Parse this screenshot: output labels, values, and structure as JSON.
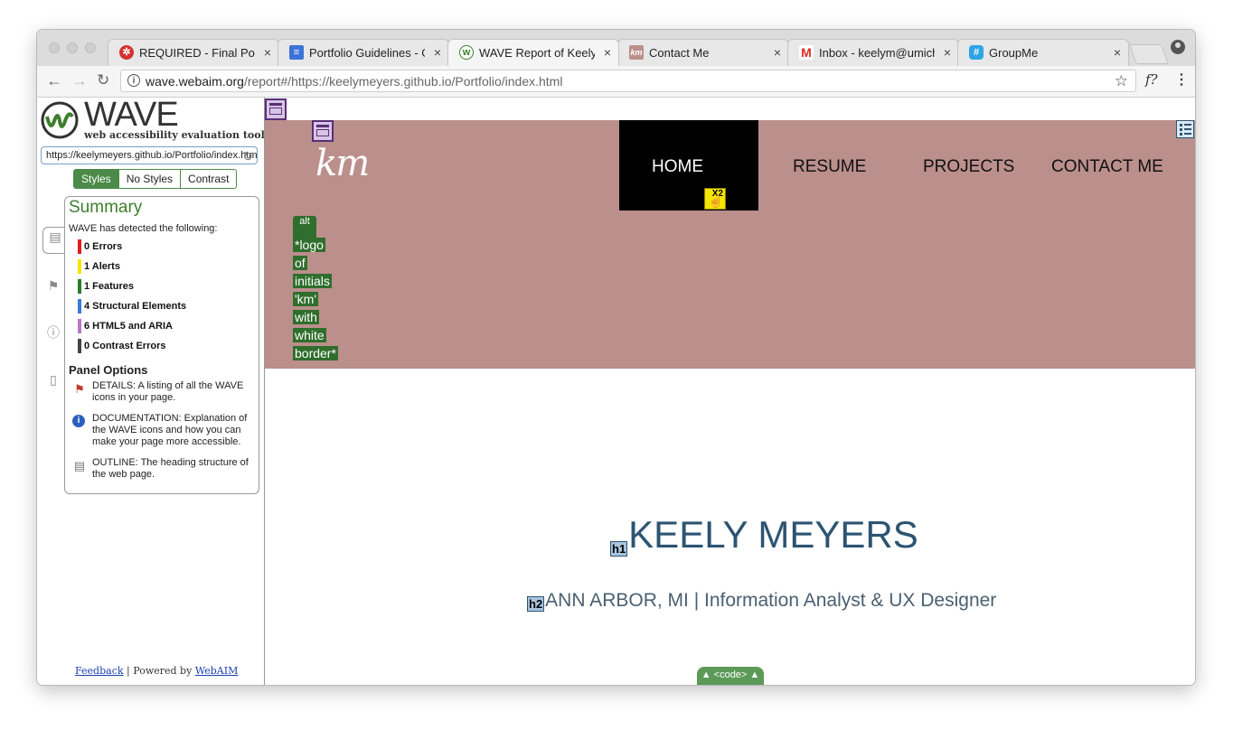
{
  "browser": {
    "tabs": [
      {
        "label": "REQUIRED - Final Portf",
        "icon": "target-icon",
        "color": "#d63031"
      },
      {
        "label": "Portfolio Guidelines - G",
        "icon": "docs-icon",
        "color": "#3b73d6"
      },
      {
        "label": "WAVE Report of Keely M",
        "icon": "wave-icon",
        "color": "#3d7f2e"
      },
      {
        "label": "Contact Me",
        "icon": "km-icon",
        "color": "#bb8f8c"
      },
      {
        "label": "Inbox - keelym@umich.",
        "icon": "gmail-icon",
        "color": "#d93025"
      },
      {
        "label": "GroupMe",
        "icon": "groupme-icon",
        "color": "#2fa4e7"
      }
    ],
    "url_host": "wave.webaim.org",
    "url_path": "/report#/https://keelymeyers.github.io/Portfolio/index.html",
    "ext_label": "f?"
  },
  "wave": {
    "title": "WAVE",
    "subtitle": "web accessibility evaluation tool",
    "url_value": "https://keelymeyers.github.io/Portfolio/index.html",
    "style_buttons": [
      "Styles",
      "No Styles",
      "Contrast"
    ],
    "summary": {
      "title": "Summary",
      "desc": "WAVE has detected the following:",
      "counts": [
        {
          "label": "0 Errors",
          "color": "#e01e1e"
        },
        {
          "label": "1 Alerts",
          "color": "#f5e600"
        },
        {
          "label": "1 Features",
          "color": "#2d7a2a"
        },
        {
          "label": "4 Structural Elements",
          "color": "#3a7bd5"
        },
        {
          "label": "6 HTML5 and ARIA",
          "color": "#b679c8"
        },
        {
          "label": "0 Contrast Errors",
          "color": "#444444"
        }
      ]
    },
    "panel_options": {
      "title": "Panel Options",
      "items": [
        {
          "text": "DETAILS: A listing of all the WAVE icons in your page."
        },
        {
          "text": "DOCUMENTATION: Explanation of the WAVE icons and how you can make your page more accessible."
        },
        {
          "text": "OUTLINE: The heading structure of the web page."
        }
      ]
    },
    "footer": {
      "feedback": "Feedback",
      "sep": "|",
      "powered": "Powered by",
      "webaim": "WebAIM"
    }
  },
  "site": {
    "logo": "km",
    "nav": [
      "HOME",
      "RESUME",
      "PROJECTS",
      "CONTACT ME"
    ],
    "alt_label": "alt",
    "alt_text": [
      "*logo",
      "of",
      "initials",
      "'km'",
      "with",
      "white",
      "border*"
    ],
    "x2_label": "X2",
    "h1_tag": "h1",
    "h1": "KEELY MEYERS",
    "h2_tag": "h2",
    "h2": "ANN ARBOR, MI | Information Analyst & UX Designer",
    "code_toggle": "▲ <code> ▲"
  }
}
